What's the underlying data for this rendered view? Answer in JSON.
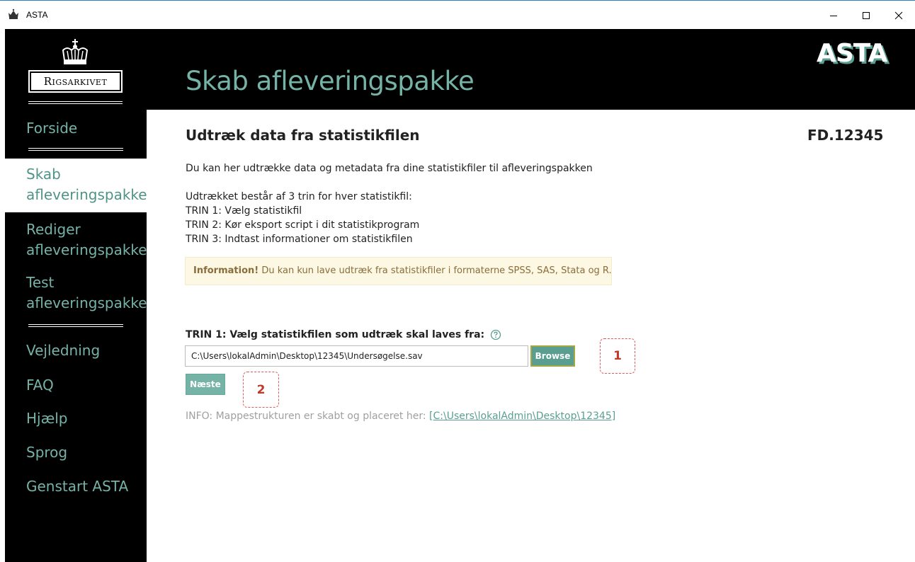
{
  "window": {
    "title": "ASTA",
    "icons": {
      "app": "crown-icon",
      "minimize": "minimize-icon",
      "maximize": "maximize-icon",
      "close": "close-icon"
    }
  },
  "header": {
    "logo_text": "Rigsarkivet",
    "page_title": "Skab afleveringspakke",
    "brand": "ASTA"
  },
  "sidebar": {
    "items": [
      {
        "label": "Forside"
      },
      {
        "label": "Skab afleveringspakke",
        "active": true
      },
      {
        "label": "Rediger afleveringspakke"
      },
      {
        "label": "Test afleveringspakke"
      },
      {
        "label": "Vejledning"
      },
      {
        "label": "FAQ"
      },
      {
        "label": "Hjælp"
      },
      {
        "label": "Sprog"
      },
      {
        "label": "Genstart ASTA"
      }
    ]
  },
  "main": {
    "section_title": "Udtræk data fra statistikfilen",
    "case_id": "FD.12345",
    "intro": "Du kan her udtrække data og metadata fra dine statistikfiler til afleveringspakken",
    "steps_heading": "Udtrækket består af 3 trin for hver statistikfil:",
    "steps": [
      "TRIN 1: Vælg statistikfil",
      "TRIN 2: Kør eksport script i dit statistikprogram",
      "TRIN 3: Indtast informationer om statistikfilen"
    ],
    "info_box": {
      "strong": "Information!",
      "text": " Du kan kun lave udtræk fra statistikfiler i formaterne SPSS, SAS, Stata og R."
    },
    "step1": {
      "label": "TRIN 1: Vælg statistikfilen som udtræk skal laves fra:",
      "path_value": "C:\\Users\\lokalAdmin\\Desktop\\12345\\Undersøgelse.sav",
      "browse_label": "Browse",
      "next_label": "Næste"
    },
    "markers": [
      "1",
      "2"
    ],
    "info_line": {
      "prefix": "INFO: Mappestrukturen er skabt og placeret her: ",
      "link": "[C:\\Users\\lokalAdmin\\Desktop\\12345]"
    }
  },
  "colors": {
    "accent": "#74b3a6",
    "accent_dark": "#5a9e91",
    "info_bg": "#fcf8e3",
    "info_text": "#8a6d3b",
    "marker": "#c0392b"
  }
}
